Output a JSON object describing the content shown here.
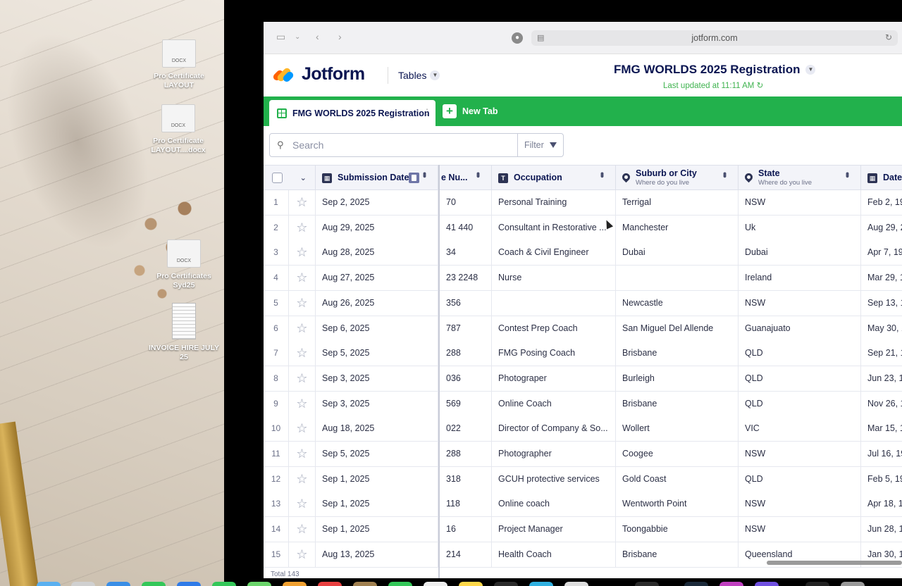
{
  "desktop": {
    "icons": [
      {
        "label": "Pro Certificate LAYOUT",
        "badge": "DOCX"
      },
      {
        "label": "Pro Certificate LAYOUT....docx",
        "badge": "DOCX"
      },
      {
        "label": "Pro Certificates Syd25",
        "badge": "DOCX"
      },
      {
        "label": "INVOICE HIRE JULY 25",
        "badge": ""
      }
    ]
  },
  "browser": {
    "url": "jotform.com",
    "icons": [
      "sidebar-icon",
      "back-icon",
      "forward-icon",
      "page-icon",
      "reload-icon"
    ]
  },
  "app": {
    "brand": "Jotform",
    "tables_menu": "Tables",
    "form_title": "FMG WORLDS 2025 Registration",
    "last_updated": "Last updated at 11:11 AM",
    "colors": {
      "brand_green": "#22b14c",
      "navy": "#0a1551",
      "updated_green": "#3fb34f"
    }
  },
  "tabs": {
    "active": "FMG WORLDS 2025 Registration",
    "new_tab": "New Tab"
  },
  "toolbar": {
    "search_placeholder": "Search",
    "filter_label": "Filter"
  },
  "table": {
    "columns": [
      {
        "label": "Submission Date",
        "sub": "",
        "icon": "calendar-icon"
      },
      {
        "label": "e Nu...",
        "sub": "",
        "icon": ""
      },
      {
        "label": "Occupation",
        "sub": "",
        "icon": "text-icon"
      },
      {
        "label": "Suburb or City",
        "sub": "Where do you live",
        "icon": "location-pin-icon"
      },
      {
        "label": "State",
        "sub": "Where do you live",
        "icon": "location-pin-icon"
      },
      {
        "label": "Date",
        "sub": "",
        "icon": "calendar-icon"
      }
    ],
    "rows": [
      {
        "n": "1",
        "date": "Sep 2, 2025",
        "phone": "70",
        "occupation": "Personal Training",
        "suburb": "Terrigal",
        "state": "NSW",
        "dob": "Feb 2, 19"
      },
      {
        "n": "2",
        "date": "Aug 29, 2025",
        "phone": "41 440",
        "occupation": "Consultant in Restorative ...",
        "suburb": "Manchester",
        "state": "Uk",
        "dob": "Aug 29, 2"
      },
      {
        "n": "3",
        "date": "Aug 28, 2025",
        "phone": "34",
        "occupation": "Coach & Civil Engineer",
        "suburb": "Dubai",
        "state": "Dubai",
        "dob": "Apr 7, 19"
      },
      {
        "n": "4",
        "date": "Aug 27, 2025",
        "phone": "23 2248",
        "occupation": "Nurse",
        "suburb": "",
        "state": "Ireland",
        "dob": "Mar 29, 1"
      },
      {
        "n": "5",
        "date": "Aug 26, 2025",
        "phone": "356",
        "occupation": "",
        "suburb": "Newcastle",
        "state": "NSW",
        "dob": "Sep 13, 19"
      },
      {
        "n": "6",
        "date": "Sep 6, 2025",
        "phone": "787",
        "occupation": "Contest Prep Coach",
        "suburb": "San Miguel Del Allende",
        "state": "Guanajuato",
        "dob": "May 30, 1"
      },
      {
        "n": "7",
        "date": "Sep 5, 2025",
        "phone": "288",
        "occupation": "FMG Posing Coach",
        "suburb": "Brisbane",
        "state": "QLD",
        "dob": "Sep 21, 19"
      },
      {
        "n": "8",
        "date": "Sep 3, 2025",
        "phone": "036",
        "occupation": "Photograper",
        "suburb": "Burleigh",
        "state": "QLD",
        "dob": "Jun 23, 19"
      },
      {
        "n": "9",
        "date": "Sep 3, 2025",
        "phone": "569",
        "occupation": "Online Coach",
        "suburb": "Brisbane",
        "state": "QLD",
        "dob": "Nov 26, 1"
      },
      {
        "n": "10",
        "date": "Aug 18, 2025",
        "phone": "022",
        "occupation": "Director of Company & So...",
        "suburb": "Wollert",
        "state": "VIC",
        "dob": "Mar 15, 19"
      },
      {
        "n": "11",
        "date": "Sep 5, 2025",
        "phone": "288",
        "occupation": "Photographer",
        "suburb": "Coogee",
        "state": "NSW",
        "dob": "Jul 16, 19"
      },
      {
        "n": "12",
        "date": "Sep 1, 2025",
        "phone": "318",
        "occupation": "GCUH protective services",
        "suburb": "Gold Coast",
        "state": "QLD",
        "dob": "Feb 5, 19"
      },
      {
        "n": "13",
        "date": "Sep 1, 2025",
        "phone": "118",
        "occupation": "Online coach",
        "suburb": "Wentworth Point",
        "state": "NSW",
        "dob": "Apr 18, 19"
      },
      {
        "n": "14",
        "date": "Sep 1, 2025",
        "phone": "16",
        "occupation": "Project Manager",
        "suburb": "Toongabbie",
        "state": "NSW",
        "dob": "Jun 28, 1"
      },
      {
        "n": "15",
        "date": "Aug 13, 2025",
        "phone": "214",
        "occupation": "Health Coach",
        "suburb": "Brisbane",
        "state": "Queensland",
        "dob": "Jan 30, 1"
      }
    ],
    "total": "Total 143"
  }
}
